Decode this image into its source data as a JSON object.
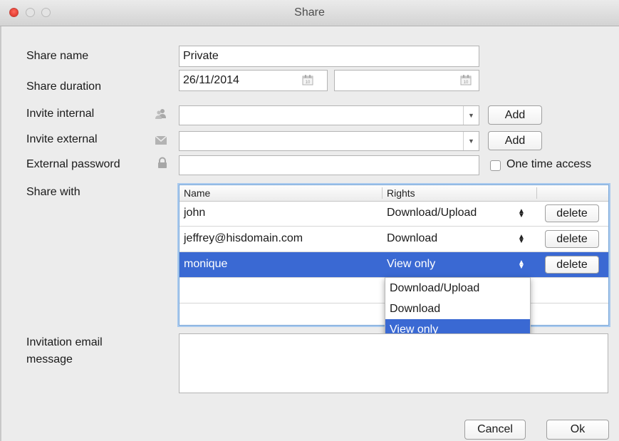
{
  "window": {
    "title": "Share"
  },
  "form": {
    "share_name_label": "Share name",
    "share_name_value": "Private",
    "share_duration_label": "Share duration",
    "start_date_value": "26/11/2014",
    "end_date_value": "",
    "invite_internal_label": "Invite internal",
    "invite_internal_value": "",
    "invite_external_label": "Invite external",
    "invite_external_value": "",
    "add_label": "Add",
    "external_password_label": "External password",
    "external_password_value": "",
    "one_time_access_label": "One time access",
    "one_time_access_checked": false,
    "share_with_label": "Share with",
    "invitation_label_line1": "Invitation email",
    "invitation_label_line2": "message",
    "invitation_message": ""
  },
  "table": {
    "columns": [
      "Name",
      "Rights"
    ],
    "delete_label": "delete",
    "rows": [
      {
        "name": "john",
        "rights": "Download/Upload",
        "selected": false
      },
      {
        "name": "jeffrey@hisdomain.com",
        "rights": "Download",
        "selected": false
      },
      {
        "name": "monique",
        "rights": "View only",
        "selected": true
      }
    ]
  },
  "rights_dropdown": {
    "options": [
      "Download/Upload",
      "Download",
      "View only"
    ],
    "selected": "View only"
  },
  "footer": {
    "cancel_label": "Cancel",
    "ok_label": "Ok"
  },
  "colors": {
    "selection": "#3a69d3",
    "close_button": "#ee4c41",
    "table_focus": "#a8c9ee"
  },
  "icons": [
    "close-window-icon",
    "minimize-window-icon",
    "maximize-window-icon",
    "calendar-icon",
    "users-icon",
    "envelope-icon",
    "lock-icon",
    "dropdown-arrow-icon",
    "stepper-icon"
  ]
}
